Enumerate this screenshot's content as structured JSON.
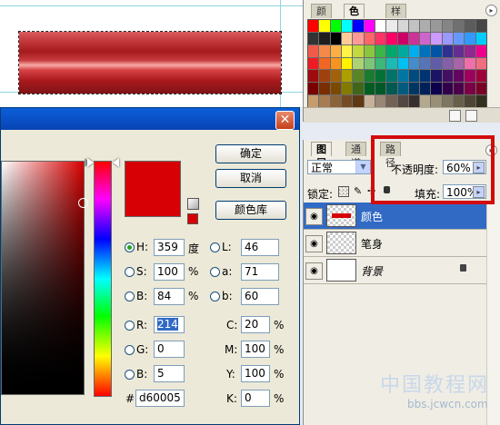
{
  "swatches_panel": {
    "tabs": [
      "颜色",
      "色板",
      "样式"
    ],
    "active_tab": "色板",
    "palette_rows": [
      [
        "#ff0000",
        "#ffff00",
        "#00ff00",
        "#00ffff",
        "#0000ff",
        "#ff00ff",
        "#ffffff",
        "#ebebeb",
        "#d6d6d6",
        "#c2c2c2",
        "#adadad",
        "#999999",
        "#858585",
        "#707070",
        "#5c5c5c",
        "#474747"
      ],
      [
        "#333333",
        "#1f1f1f",
        "#000000",
        "#ffcc99",
        "#ff9999",
        "#ff6666",
        "#ff3366",
        "#ff0066",
        "#cc0066",
        "#cc3399",
        "#cc66cc",
        "#cc99ff",
        "#9999ff",
        "#6699ff",
        "#3399ff",
        "#00ccff"
      ],
      [
        "#f15a4a",
        "#f58a48",
        "#fbaf43",
        "#fff34a",
        "#c3d940",
        "#8cc63e",
        "#3ab54a",
        "#00a86b",
        "#00ab9d",
        "#00adef",
        "#0072bc",
        "#0054a5",
        "#2e3192",
        "#652d91",
        "#92278f",
        "#ec008c"
      ],
      [
        "#ed1c24",
        "#f26522",
        "#f7941d",
        "#fff200",
        "#acd373",
        "#7cc576",
        "#3cb878",
        "#1abbb4",
        "#00bff3",
        "#448ccb",
        "#5674b9",
        "#605ca8",
        "#855fa8",
        "#a864a8",
        "#f06eaa",
        "#f26d7d"
      ],
      [
        "#9e0b0f",
        "#a0410d",
        "#a36209",
        "#aba000",
        "#598527",
        "#197b30",
        "#007236",
        "#00746b",
        "#0076a3",
        "#004b80",
        "#003471",
        "#1b1464",
        "#440e62",
        "#630460",
        "#9e005d",
        "#9e0039"
      ],
      [
        "#790000",
        "#7b2e00",
        "#7d4900",
        "#827b00",
        "#406618",
        "#005e20",
        "#005826",
        "#005952",
        "#005b7f",
        "#003663",
        "#002157",
        "#0d004c",
        "#32004b",
        "#4b0049",
        "#7b0046",
        "#7a0026"
      ],
      [
        "#c69c6d",
        "#a67c52",
        "#8c6239",
        "#754c24",
        "#603913",
        "#c7b299",
        "#998675",
        "#736357",
        "#534741",
        "#362f2d",
        "#b3a98f",
        "#998f76",
        "#7f7660",
        "#665f4a",
        "#4d4635",
        "#33301f"
      ]
    ]
  },
  "layers_panel": {
    "tabs": [
      "图层",
      "通道",
      "路径"
    ],
    "active_tab": "图层",
    "blend_mode": "正常",
    "opacity_label": "不透明度:",
    "opacity_value": "60%",
    "lock_label": "锁定:",
    "fill_label": "填充:",
    "fill_value": "100%",
    "layers": [
      {
        "name": "颜色",
        "selected": true,
        "visible": true
      },
      {
        "name": "笔身",
        "selected": false,
        "visible": true
      },
      {
        "name": "背景",
        "selected": false,
        "visible": true,
        "locked": true
      }
    ],
    "eye_icon": "eye-icon",
    "lock_icon": "lock-icon"
  },
  "color_picker": {
    "close_label": "✕",
    "ok_label": "确定",
    "cancel_label": "取消",
    "library_label": "颜色库",
    "current_color": "#d60005",
    "hsb": [
      {
        "key": "H:",
        "value": "359",
        "unit": "度",
        "selected": true
      },
      {
        "key": "S:",
        "value": "100",
        "unit": "%",
        "selected": false
      },
      {
        "key": "B:",
        "value": "84",
        "unit": "%",
        "selected": false
      }
    ],
    "rgb": [
      {
        "key": "R:",
        "value": "214"
      },
      {
        "key": "G:",
        "value": "0"
      },
      {
        "key": "B:",
        "value": "5"
      }
    ],
    "lab": [
      {
        "key": "L:",
        "value": "46"
      },
      {
        "key": "a:",
        "value": "71"
      },
      {
        "key": "b:",
        "value": "60"
      }
    ],
    "cmyk": [
      {
        "key": "C:",
        "value": "20",
        "unit": "%"
      },
      {
        "key": "M:",
        "value": "100",
        "unit": "%"
      },
      {
        "key": "Y:",
        "value": "100",
        "unit": "%"
      },
      {
        "key": "K:",
        "value": "0",
        "unit": "%"
      }
    ],
    "hex_label": "#",
    "hex_value": "d60005"
  },
  "watermark": {
    "line1": "中国教程网",
    "line2": "bbs.jcwcn.com"
  }
}
